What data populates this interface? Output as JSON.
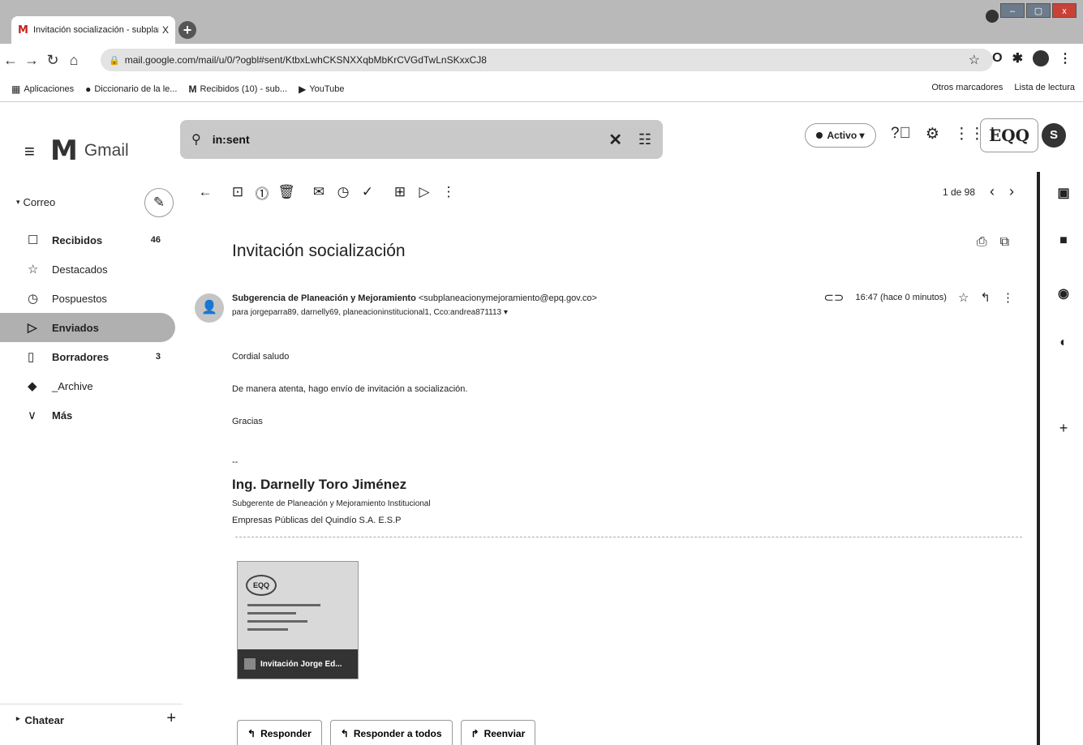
{
  "browser": {
    "tab_title": "Invitación socialización - subplan",
    "tab_close": "X",
    "new_tab": "+",
    "url": "mail.google.com/mail/u/0/?ogbl#sent/KtbxLwhCKSNXXqbMbKrCVGdTwLnSKxxCJ8",
    "window_controls": [
      "–",
      "▢",
      "x"
    ]
  },
  "bookmarks": {
    "items": [
      {
        "icon": "apps-grid-icon",
        "label": "Aplicaciones"
      },
      {
        "icon": "dictionary-icon",
        "label": "Diccionario de la le..."
      },
      {
        "icon": "gmail-icon",
        "label": "Recibidos (10) - sub..."
      },
      {
        "icon": "youtube-icon",
        "label": "YouTube"
      }
    ],
    "other": "Otros marcadores",
    "reading_list": "Lista de lectura"
  },
  "gmail": {
    "product_name": "Gmail",
    "search_value": "in:sent",
    "status": "Activo",
    "org_logo_text": "EQQ",
    "avatar_letter": "S"
  },
  "sidebar": {
    "section": "Correo",
    "items": [
      {
        "icon": "inbox-icon",
        "label": "Recibidos",
        "count": "46"
      },
      {
        "icon": "star-icon",
        "label": "Destacados",
        "count": ""
      },
      {
        "icon": "clock-icon",
        "label": "Pospuestos",
        "count": ""
      },
      {
        "icon": "send-icon",
        "label": "Enviados",
        "count": ""
      },
      {
        "icon": "draft-icon",
        "label": "Borradores",
        "count": "3"
      },
      {
        "icon": "label-icon",
        "label": "_Archive",
        "count": ""
      },
      {
        "icon": "chevron-down-icon",
        "label": "Más",
        "count": ""
      }
    ],
    "chat_label": "Chatear"
  },
  "toolbar": {
    "pager": "1 de 98"
  },
  "message": {
    "subject": "Invitación socialización",
    "sender_name": "Subgerencia de Planeación y Mejoramiento",
    "sender_email": "<subplaneacionymejoramiento@epq.gov.co>",
    "recipients": "para jorgeparra89, darnelly69, planeacioninstitucional1, Cco:andrea871113",
    "time": "16:47 (hace 0 minutos)",
    "body": [
      "Cordial saludo",
      "De manera atenta, hago envío de invitación a socialización.",
      "Gracias"
    ],
    "signature": {
      "dash": "--",
      "name": "Ing. Darnelly Toro Jiménez",
      "title": "Subgerente de Planeación y Mejoramiento Institucional",
      "company": "Empresas Públicas del Quindío S.A. E.S.P"
    },
    "attachment_name": "Invitación Jorge Ed..."
  },
  "reply_actions": {
    "reply": "Responder",
    "reply_all": "Responder a todos",
    "forward": "Reenviar"
  }
}
